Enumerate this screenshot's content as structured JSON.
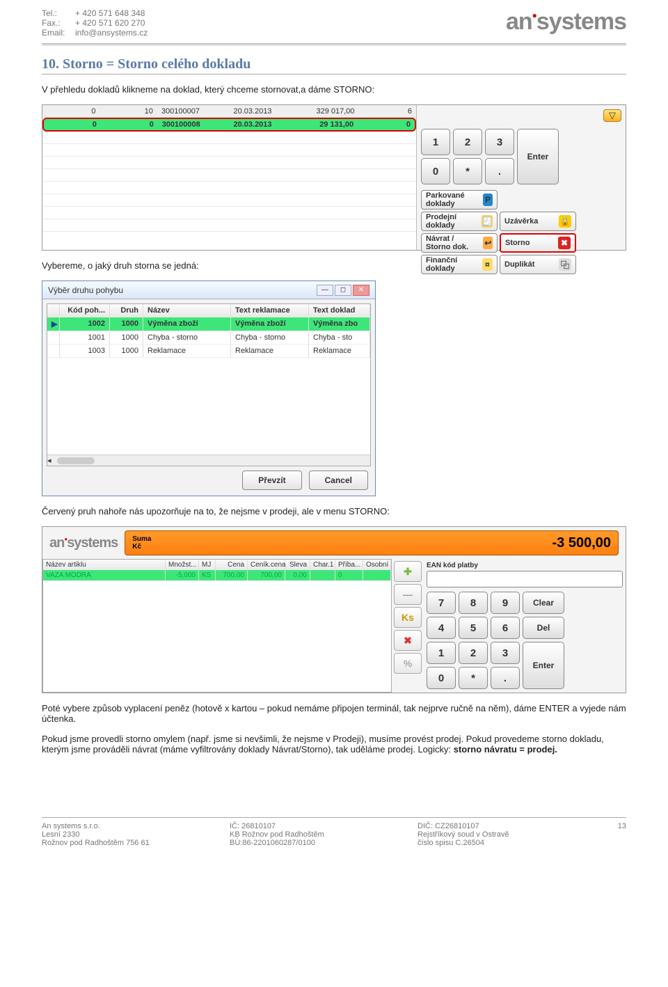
{
  "header": {
    "tel_label": "Tel.:",
    "tel": "+ 420 571 648 348",
    "fax_label": "Fax.:",
    "fax": "+ 420 571 620 270",
    "email_label": "Email:",
    "email": "info@ansystems.cz",
    "logo1": "an",
    "logo2": "systems"
  },
  "section": {
    "title": "10. Storno = Storno celého dokladu"
  },
  "p1": "V přehledu dokladů klikneme  na doklad, který chceme stornovat,a dáme STORNO:",
  "shot1": {
    "row_dim": [
      "0",
      "10",
      "300100007",
      "20.03.2013",
      "329 017,00",
      "6"
    ],
    "row_hl": [
      "0",
      "0",
      "300100008",
      "20.03.2013",
      "29 131,00",
      "0"
    ],
    "keys": {
      "k1": "1",
      "k2": "2",
      "k3": "3",
      "k0": "0",
      "ks": "*",
      "kd": ".",
      "enter": "Enter"
    },
    "actions": {
      "park": "Parkované doklady",
      "prod": "Prodejní doklady",
      "navr": "Návrat / Storno dok.",
      "fin": "Finanční doklady",
      "uzav": "Uzávěrka",
      "storno": "Storno",
      "dup": "Duplikát"
    }
  },
  "p2": "Vybereme, o jaký druh storna se jedná:",
  "shot2": {
    "title": "Výběr druhu pohybu",
    "hdr": {
      "kod": "Kód poh...",
      "druh": "Druh",
      "nazev": "Název",
      "rek": "Text reklamace",
      "dokl": "Text doklad"
    },
    "rows": [
      {
        "mark": "▶",
        "kod": "1002",
        "druh": "1000",
        "nazev": "Výměna zboží",
        "rek": "Výměna zboží",
        "dokl": "Výměna zbo"
      },
      {
        "mark": "",
        "kod": "1001",
        "druh": "1000",
        "nazev": "Chyba - storno",
        "rek": "Chyba - storno",
        "dokl": "Chyba - sto"
      },
      {
        "mark": "",
        "kod": "1003",
        "druh": "1000",
        "nazev": "Reklamace",
        "rek": "Reklamace",
        "dokl": "Reklamace"
      }
    ],
    "btn1": "Převzít",
    "btn2": "Cancel"
  },
  "p3": "Červený pruh nahoře nás upozorňuje na to, že nejsme v prodeji, ale v menu STORNO:",
  "shot3": {
    "suma_label": "Suma",
    "kc_label": "Kč",
    "amount": "-3 500,00",
    "item_hdr": {
      "name": "Název artiklu",
      "qty": "Množst...",
      "mj": "MJ",
      "cena": "Cena",
      "ccena": "Ceník.cena",
      "sleva": "Sleva",
      "ch": "Char.1",
      "pr": "Příba...",
      "os": "Osobní"
    },
    "item_row": {
      "name": "VAZA MODRA",
      "qty": "-5,000",
      "mj": "KS",
      "cena": "700,00",
      "ccena": "700,00",
      "sleva": "0,00",
      "ch": "",
      "pr": "0",
      "os": ""
    },
    "side": {
      "plus": "✚",
      "minus": "—",
      "ks": "Ks",
      "x": "✖",
      "pct": "%"
    },
    "ean_label": "EAN kód platby",
    "keys": {
      "k7": "7",
      "k8": "8",
      "k9": "9",
      "clear": "Clear",
      "k4": "4",
      "k5": "5",
      "k6": "6",
      "del": "Del",
      "k1": "1",
      "k2": "2",
      "k3": "3",
      "enter": "Enter",
      "k0": "0",
      "ks": "*",
      "kd": "."
    }
  },
  "p4": "Poté vybere způsob vyplacení peněz (hotově x kartou – pokud nemáme připojen terminál, tak nejprve ručně na něm), dáme ENTER a vyjede nám účtenka.",
  "p5": "Pokud jsme provedli storno omylem (např. jsme si nevšimli, že nejsme v Prodeji), musíme provést prodej. Pokud provedeme storno dokladu, kterým jsme prováděli návrat (máme vyfiltrovány doklady Návrat/Storno), tak uděláme prodej. Logicky:",
  "p5b": " storno návratu = prodej.",
  "footer": {
    "c1a": "An systems s.r.o.",
    "c1b": "Lesní 2330",
    "c1c": "Rožnov pod Radhoštěm 756 61",
    "c2a": "IČ: 26810107",
    "c2b": "KB Rožnov pod Radhoštěm",
    "c2c": "BÚ:86-2201060287/0100",
    "c3a": "DIČ: CZ26810107",
    "c3b": "Rejstříkový soud v Ostravě",
    "c3c": "číslo spisu C.26504",
    "page": "13"
  }
}
